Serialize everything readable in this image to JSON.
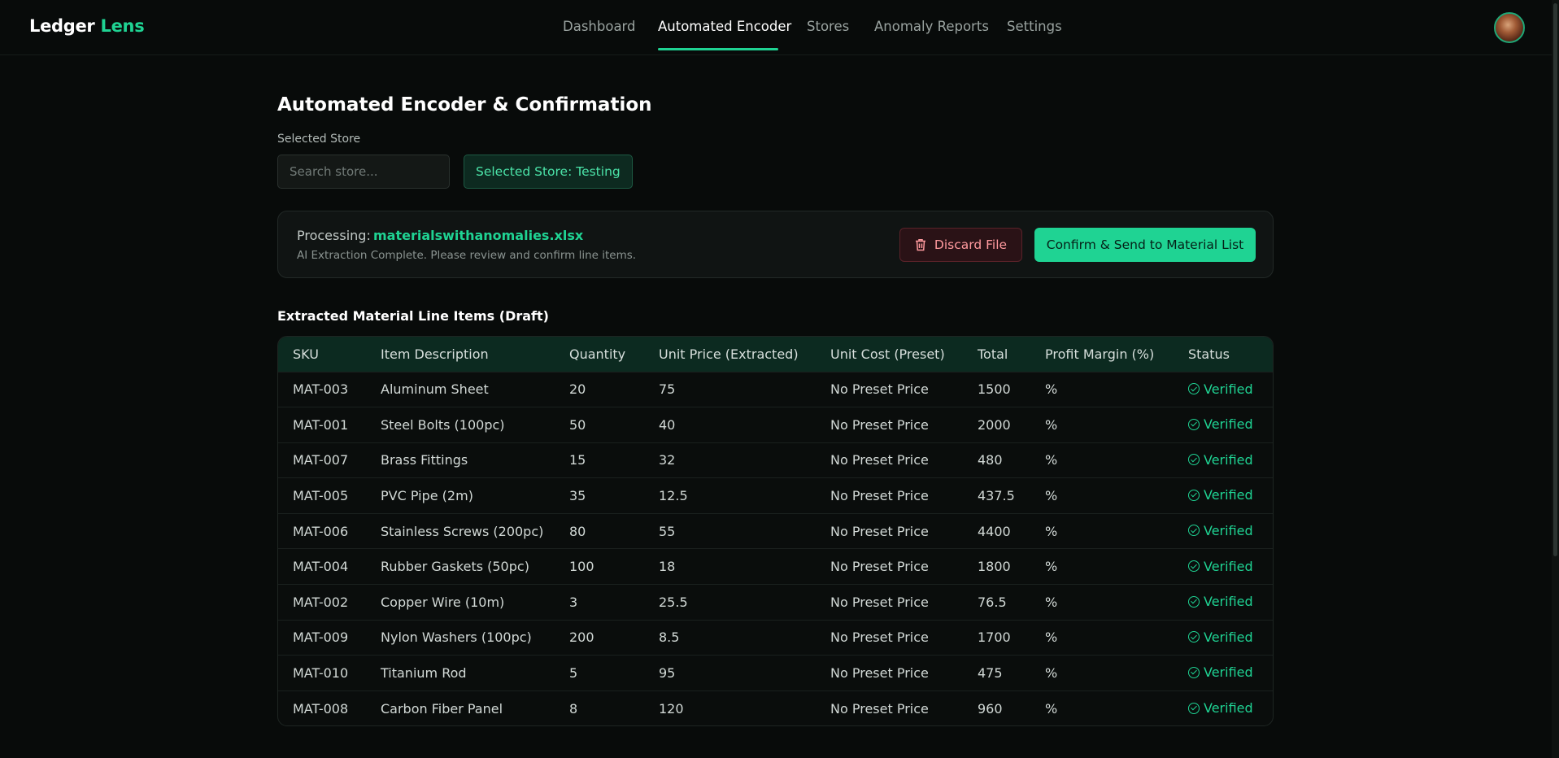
{
  "brand": {
    "part1": "Ledger",
    "part2": "Lens"
  },
  "nav": [
    {
      "label": "Dashboard",
      "active": false
    },
    {
      "label": "Automated Encoder",
      "active": true
    },
    {
      "label": "Stores",
      "active": false
    },
    {
      "label": "Anomaly Reports",
      "active": false
    },
    {
      "label": "Settings",
      "active": false
    }
  ],
  "page": {
    "title": "Automated Encoder & Confirmation"
  },
  "store": {
    "label": "Selected Store",
    "search_placeholder": "Search store...",
    "selected_badge": "Selected Store: Testing"
  },
  "processing": {
    "label": "Processing:",
    "file_name": "materialswithanomalies.xlsx",
    "subtitle": "AI Extraction Complete. Please review and confirm line items.",
    "discard_label": "Discard File",
    "confirm_label": "Confirm & Send to Material List"
  },
  "table": {
    "title": "Extracted Material Line Items (Draft)",
    "headers": [
      "SKU",
      "Item Description",
      "Quantity",
      "Unit Price (Extracted)",
      "Unit Cost (Preset)",
      "Total",
      "Profit Margin (%)",
      "Status"
    ],
    "rows": [
      [
        "MAT-003",
        "Aluminum Sheet",
        "20",
        "75",
        "No Preset Price",
        "1500",
        "%",
        "Verified"
      ],
      [
        "MAT-001",
        "Steel Bolts (100pc)",
        "50",
        "40",
        "No Preset Price",
        "2000",
        "%",
        "Verified"
      ],
      [
        "MAT-007",
        "Brass Fittings",
        "15",
        "32",
        "No Preset Price",
        "480",
        "%",
        "Verified"
      ],
      [
        "MAT-005",
        "PVC Pipe (2m)",
        "35",
        "12.5",
        "No Preset Price",
        "437.5",
        "%",
        "Verified"
      ],
      [
        "MAT-006",
        "Stainless Screws (200pc)",
        "80",
        "55",
        "No Preset Price",
        "4400",
        "%",
        "Verified"
      ],
      [
        "MAT-004",
        "Rubber Gaskets (50pc)",
        "100",
        "18",
        "No Preset Price",
        "1800",
        "%",
        "Verified"
      ],
      [
        "MAT-002",
        "Copper Wire (10m)",
        "3",
        "25.5",
        "No Preset Price",
        "76.5",
        "%",
        "Verified"
      ],
      [
        "MAT-009",
        "Nylon Washers (100pc)",
        "200",
        "8.5",
        "No Preset Price",
        "1700",
        "%",
        "Verified"
      ],
      [
        "MAT-010",
        "Titanium Rod",
        "5",
        "95",
        "No Preset Price",
        "475",
        "%",
        "Verified"
      ],
      [
        "MAT-008",
        "Carbon Fiber Panel",
        "8",
        "120",
        "No Preset Price",
        "960",
        "%",
        "Verified"
      ]
    ]
  },
  "colors": {
    "accent": "#1fd393",
    "background": "#080b0a",
    "danger": "#ff9a9e"
  }
}
